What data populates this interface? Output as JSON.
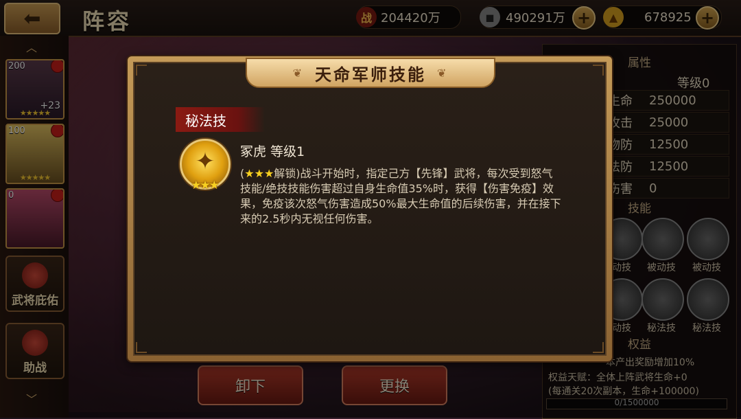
{
  "topbar": {
    "back_label": "⬅",
    "title": "阵容",
    "combat_icon": "战",
    "combat_power": "204420万",
    "coins": "490291万",
    "gold": "678925",
    "plus": "+"
  },
  "left_column": {
    "heroes": [
      {
        "level": "200",
        "stars": "★★★★★",
        "extra": "+23"
      },
      {
        "level": "100",
        "stars": "★★★★★",
        "extra": ""
      },
      {
        "level": "0",
        "stars": "",
        "extra": ""
      }
    ],
    "blessing_label": "武将庇佑",
    "assist_label": "助战"
  },
  "right_panel": {
    "attr_header": "属性",
    "level_label": "等级0",
    "stats": [
      {
        "key": "生命",
        "value": "250000"
      },
      {
        "key": "攻击",
        "value": "25000"
      },
      {
        "key": "物防",
        "value": "12500"
      },
      {
        "key": "法防",
        "value": "12500"
      },
      {
        "key": "伤害",
        "value": "0"
      }
    ],
    "skills_header": "技能",
    "skills_row1": [
      "动技",
      "被动技",
      "被动技"
    ],
    "skills_row2": [
      "动技",
      "秘法技",
      "秘法技"
    ],
    "benefit_header": "权益",
    "benefit_line1": "本产出奖励增加10%",
    "benefit_line2": "权益天赋：全体上阵武将生命+0",
    "benefit_line3": "(每通关20次副本，生命+100000)",
    "progress_text": "0/1500000",
    "progress_value": 0
  },
  "bottom": {
    "unload_label": "卸下",
    "replace_label": "更换"
  },
  "modal": {
    "title": "天命军师技能",
    "category": "秘法技",
    "skill_name": "冢虎 等级1",
    "icon_stars": "★★★",
    "desc_prefix": "(",
    "desc_stars": "★★★",
    "desc_unlock": "解锁)",
    "desc_body": "战斗开始时，指定己方【先锋】武将，每次受到怒气技能/绝技技能伤害超过自身生命值35%时，获得【伤害免疫】效果，免疫该次怒气伤害造成50%最大生命值的后续伤害，并在接下来的2.5秒内无视任何伤害。"
  },
  "colors": {
    "accent_gold": "#d0a462",
    "danger_red": "#b23a2a",
    "star_yellow": "#f8d020"
  }
}
